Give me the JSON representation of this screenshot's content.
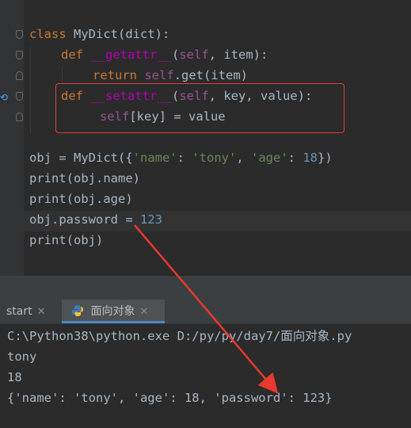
{
  "editor": {
    "lines": [
      {
        "id": "l1",
        "text": "class MyDict(dict):"
      },
      {
        "id": "l2",
        "text": "def __getattr__(self, item):"
      },
      {
        "id": "l3",
        "text": "return self.get(item)"
      },
      {
        "id": "l4",
        "text": "def __setattr__(self, key, value):"
      },
      {
        "id": "l5",
        "text": "self[key] = value"
      },
      {
        "id": "l6",
        "text": "obj = MyDict({'name': 'tony', 'age': 18})"
      },
      {
        "id": "l7",
        "text": "print(obj.name)"
      },
      {
        "id": "l8",
        "text": "print(obj.age)"
      },
      {
        "id": "l9",
        "text": "obj.password = 123"
      },
      {
        "id": "l10",
        "text": "print(obj)"
      }
    ]
  },
  "run_panel": {
    "tabs": [
      {
        "label": "start",
        "active": false
      },
      {
        "label": "面向对象",
        "active": true
      }
    ],
    "output": [
      "C:\\Python38\\python.exe D:/py/py/day7/面向对象.py",
      "tony",
      "18",
      "{'name': 'tony', 'age': 18, 'password': 123}"
    ]
  },
  "colors": {
    "annotation": "#e0413a",
    "background": "#2b2b2b"
  },
  "icons": [
    "fold-marker-icon",
    "override-marker-icon",
    "python-file-icon",
    "close-icon"
  ]
}
